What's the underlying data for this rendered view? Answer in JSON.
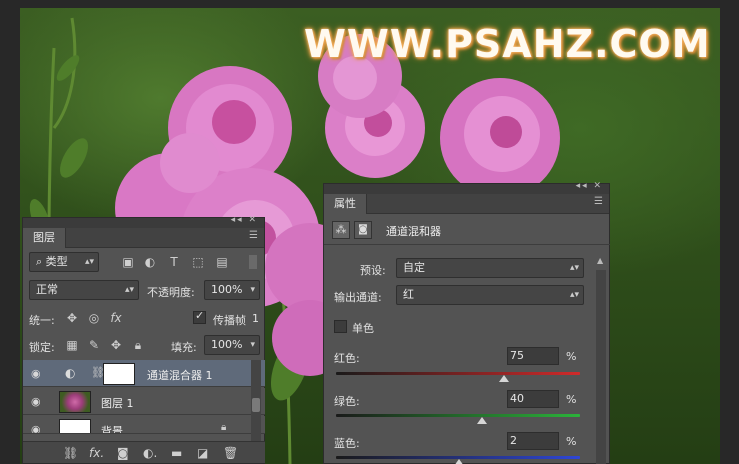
{
  "watermark": "WWW.PSAHZ.COM",
  "layers_panel": {
    "tab": "图层",
    "filter_kind": "类型",
    "blend_mode": "正常",
    "opacity_label": "不透明度:",
    "opacity_value": "100%",
    "unify_label": "统一:",
    "propagate_label": "传播帧",
    "propagate_value": "1",
    "lock_label": "锁定:",
    "fill_label": "填充:",
    "fill_value": "100%",
    "layers": [
      {
        "name": "通道混合器 1",
        "selected": true
      },
      {
        "name": "图层 1",
        "selected": false
      },
      {
        "name": "背景",
        "selected": false
      }
    ]
  },
  "properties_panel": {
    "tab": "属性",
    "title": "通道混和器",
    "preset_label": "预设:",
    "preset_value": "自定",
    "output_label": "输出通道:",
    "output_value": "红",
    "mono_label": "单色",
    "channels": [
      {
        "label": "红色:",
        "value": "75",
        "unit": "%",
        "percent": 75,
        "color": "#d02a2a"
      },
      {
        "label": "绿色:",
        "value": "40",
        "unit": "%",
        "percent": 40,
        "color": "#2bb33a"
      },
      {
        "label": "蓝色:",
        "value": "2",
        "unit": "%",
        "percent": 2,
        "color": "#2e46d6"
      }
    ]
  }
}
